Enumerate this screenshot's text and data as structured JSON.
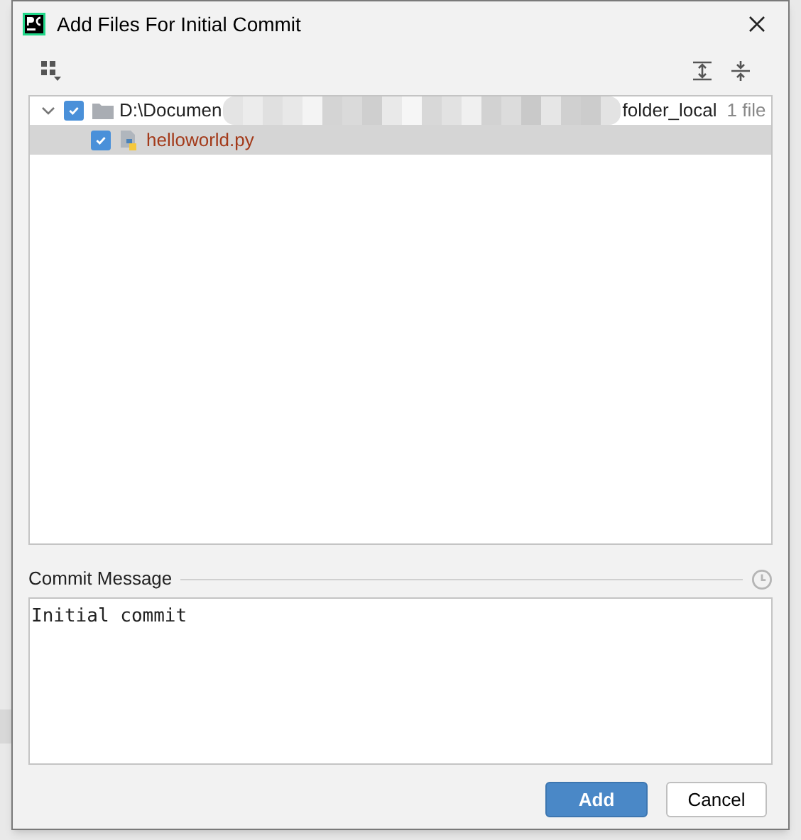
{
  "window": {
    "title": "Add Files For Initial Commit"
  },
  "tree": [
    {
      "label_start": "D:\\Documen",
      "label_end": "folder_local",
      "count": "1 file",
      "checked": true,
      "expanded": true,
      "selected": false,
      "children": [
        {
          "label": "helloworld.py",
          "checked": true,
          "selected": true
        }
      ]
    }
  ],
  "commit_message": {
    "label": "Commit Message",
    "value": "Initial commit"
  },
  "buttons": [
    {
      "label": "Add",
      "kind": "primary"
    },
    {
      "label": "Cancel",
      "kind": "secondary"
    }
  ]
}
